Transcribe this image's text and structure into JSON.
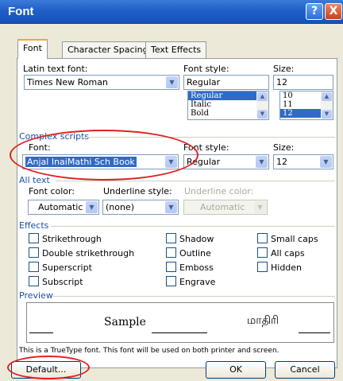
{
  "window": {
    "title": "Font",
    "help_label": "?",
    "close_label": "X"
  },
  "tabs": [
    {
      "label": "Font"
    },
    {
      "label": "Character Spacing"
    },
    {
      "label": "Text Effects"
    }
  ],
  "latin": {
    "font_label": "Latin text font:",
    "font_value": "Times New Roman",
    "style_label": "Font style:",
    "style_value": "Regular",
    "style_options": [
      "Regular",
      "Italic",
      "Bold"
    ],
    "size_label": "Size:",
    "size_value": "12",
    "size_options": [
      "10",
      "11",
      "12"
    ]
  },
  "complex": {
    "group_label": "Complex scripts",
    "font_label": "Font:",
    "font_value": "Anjal InaiMathi Sch Book",
    "style_label": "Font style:",
    "style_value": "Regular",
    "size_label": "Size:",
    "size_value": "12"
  },
  "all_text": {
    "group_label": "All text",
    "color_label": "Font color:",
    "color_value": "Automatic",
    "underline_label": "Underline style:",
    "underline_value": "(none)",
    "underline_color_label": "Underline color:",
    "underline_color_value": "Automatic"
  },
  "effects": {
    "group_label": "Effects",
    "col1": [
      "Strikethrough",
      "Double strikethrough",
      "Superscript",
      "Subscript"
    ],
    "col2": [
      "Shadow",
      "Outline",
      "Emboss",
      "Engrave"
    ],
    "col3": [
      "Small caps",
      "All caps",
      "Hidden"
    ]
  },
  "preview": {
    "group_label": "Preview",
    "sample_text": "Sample",
    "tamil_text": "மாதிரி",
    "note": "This is a TrueType font. This font will be used on both printer and screen."
  },
  "buttons": {
    "default_label": "Default...",
    "ok_label": "OK",
    "cancel_label": "Cancel"
  },
  "colors": {
    "titlebar": "#1f5fc8",
    "annotation": "#e02020",
    "selection": "#316ac5"
  }
}
